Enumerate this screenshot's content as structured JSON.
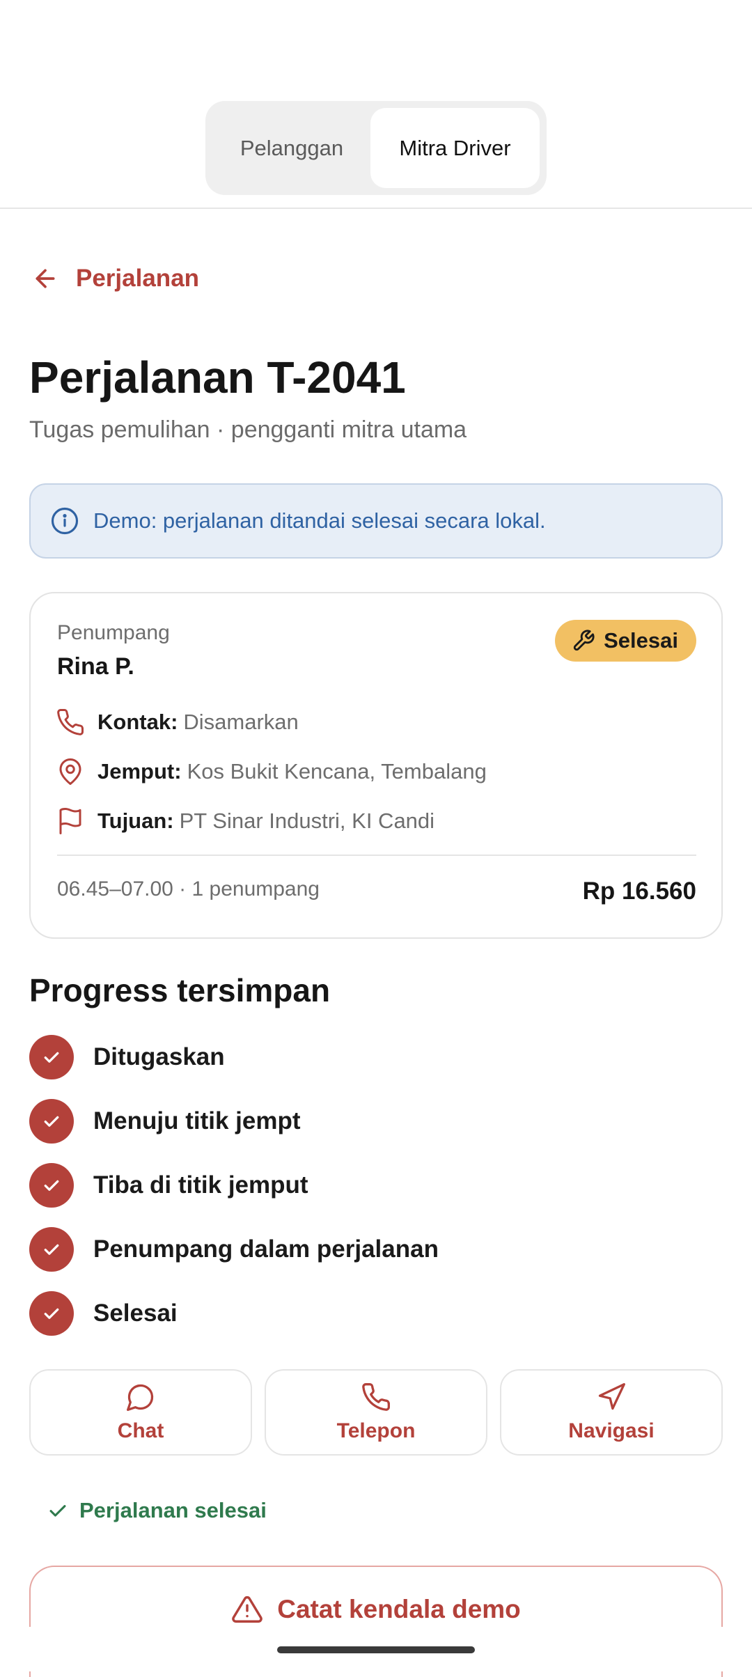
{
  "segmented": {
    "tabs": [
      "Pelanggan",
      "Mitra Driver"
    ],
    "active": "Mitra Driver"
  },
  "back": {
    "label": "Perjalanan"
  },
  "header": {
    "title": "Perjalanan T-2041",
    "subtitle": "Tugas pemulihan · pengganti mitra utama"
  },
  "info_banner": {
    "text": "Demo: perjalanan ditandai selesai secara lokal."
  },
  "trip_card": {
    "passenger_label": "Penumpang",
    "passenger_name": "Rina P.",
    "status_badge": "Selesai",
    "contact_label": "Kontak:",
    "contact_value": "Disamarkan",
    "pickup_label": "Jemput:",
    "pickup_value": "Kos Bukit Kencana, Tembalang",
    "destination_label": "Tujuan:",
    "destination_value": "PT Sinar Industri, KI Candi",
    "time_info": "06.45–07.00 · 1 penumpang",
    "price": "Rp 16.560"
  },
  "progress": {
    "title": "Progress tersimpan",
    "steps": [
      "Ditugaskan",
      "Menuju titik jempt",
      "Tiba di titik jemput",
      "Penumpang dalam perjalanan",
      "Selesai"
    ]
  },
  "actions": {
    "chat": "Chat",
    "call": "Telepon",
    "navigate": "Navigasi"
  },
  "completion": {
    "text": "Perjalanan selesai"
  },
  "report_button": {
    "label": "Catat kendala demo"
  },
  "colors": {
    "accent": "#b3413a",
    "badge": "#f2c063",
    "info_bg": "#e7eef7",
    "success": "#2f7a4d"
  }
}
